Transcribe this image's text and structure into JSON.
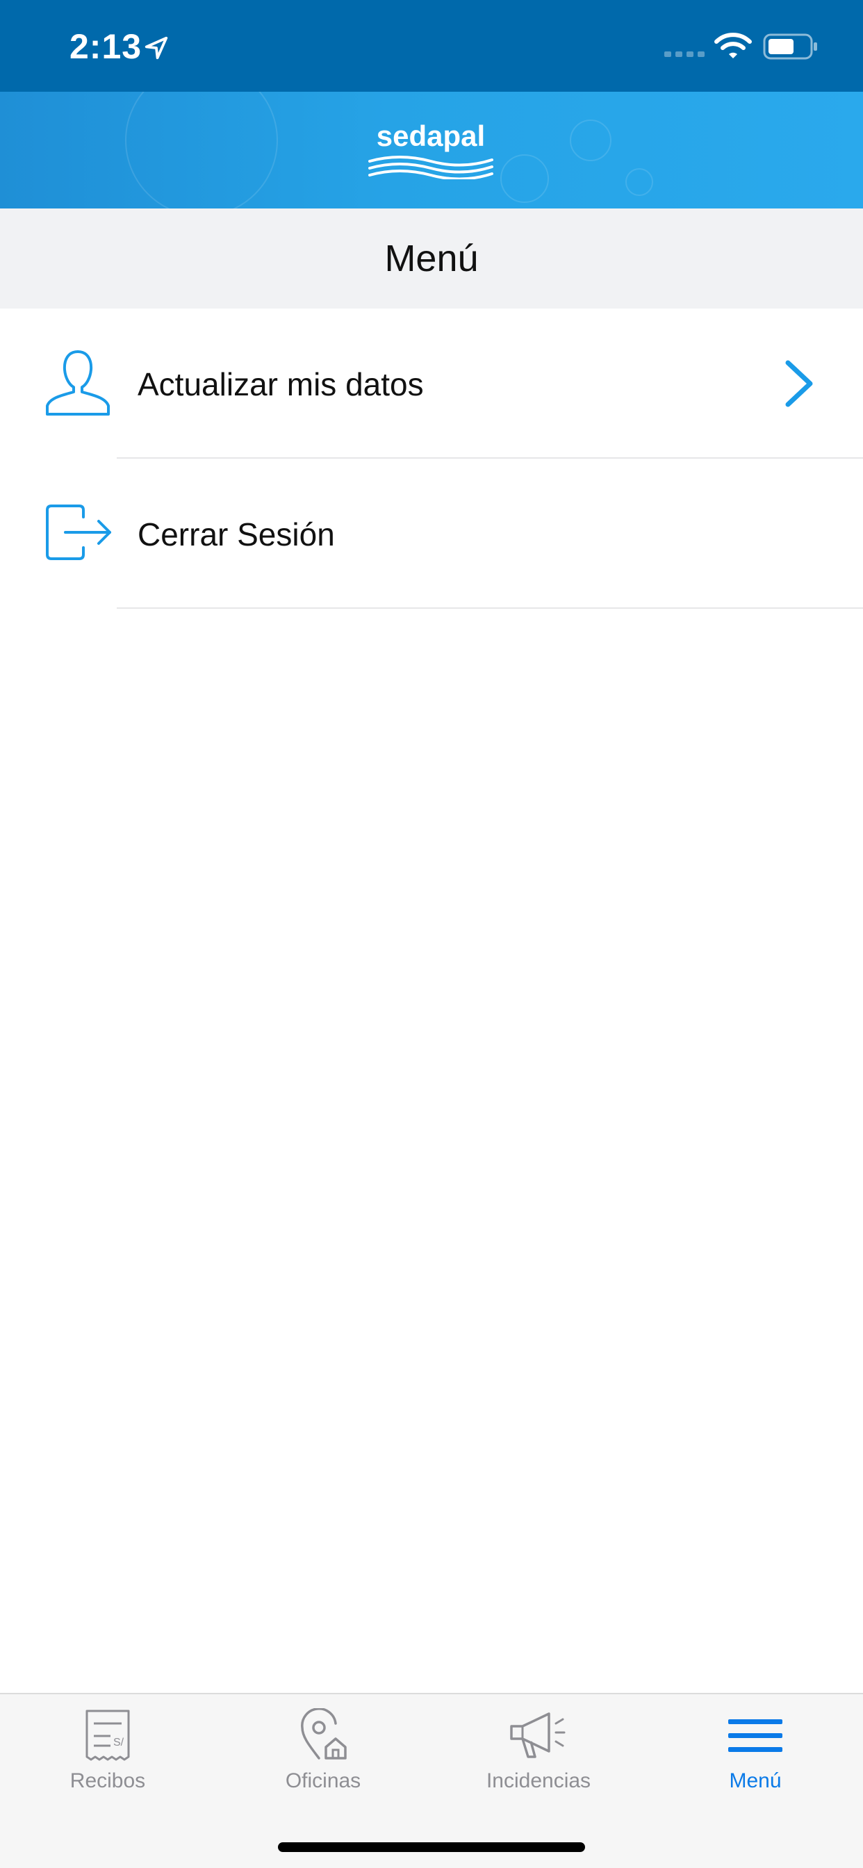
{
  "status_bar": {
    "time": "2:13"
  },
  "header": {
    "logo_text": "sedapal"
  },
  "title": "Menú",
  "menu": {
    "items": [
      {
        "label": "Actualizar mis datos",
        "icon": "user-outline-icon",
        "has_chevron": true
      },
      {
        "label": "Cerrar Sesión",
        "icon": "logout-icon",
        "has_chevron": false
      }
    ]
  },
  "tab_bar": {
    "tabs": [
      {
        "label": "Recibos",
        "icon": "receipt-icon",
        "active": false
      },
      {
        "label": "Oficinas",
        "icon": "office-location-icon",
        "active": false
      },
      {
        "label": "Incidencias",
        "icon": "megaphone-icon",
        "active": false
      },
      {
        "label": "Menú",
        "icon": "hamburger-menu-icon",
        "active": true
      }
    ]
  },
  "colors": {
    "status_bar": "#0069ab",
    "banner": "#26a3e6",
    "accent": "#1a9be8",
    "tab_active": "#0a7ae8",
    "tab_inactive": "#8e8e93"
  }
}
